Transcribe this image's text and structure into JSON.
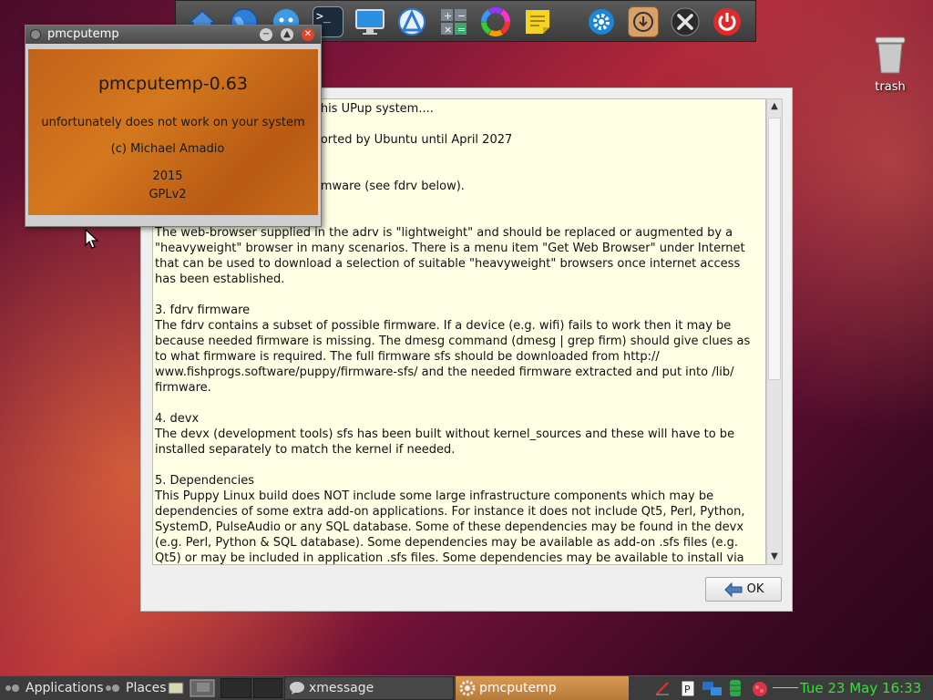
{
  "desktop": {
    "trash_label": "trash"
  },
  "dock": {
    "items": [
      {
        "name": "home",
        "icon": "home-icon"
      },
      {
        "name": "browser",
        "icon": "globe-icon"
      },
      {
        "name": "chat",
        "icon": "chat-icon"
      },
      {
        "name": "terminal",
        "icon": "terminal-icon",
        "glyph": ">_"
      },
      {
        "name": "display",
        "icon": "monitor-icon"
      },
      {
        "name": "file-manager",
        "icon": "triangle-app-icon"
      },
      {
        "name": "calculator",
        "icon": "calculator-icon"
      },
      {
        "name": "color-picker",
        "icon": "color-wheel-icon"
      },
      {
        "name": "notes",
        "icon": "sticky-note-icon"
      },
      {
        "name": "settings",
        "icon": "gear-icon"
      },
      {
        "name": "installer",
        "icon": "download-box-icon"
      },
      {
        "name": "tools",
        "icon": "tools-icon"
      },
      {
        "name": "shutdown",
        "icon": "power-icon"
      }
    ]
  },
  "message_window": {
    "text": "                                            his UPup system....\n\n                                            orted by Ubuntu until April 2027\n\n\n                                            mware (see fdrv below).\n\n\nThe web-browser supplied in the adrv is \"lightweight\" and should be replaced or augmented by a \"heavyweight\" browser in many scenarios. There is a menu item \"Get Web Browser\" under Internet that can be used to download a selection of suitable \"heavyweight\" browsers once internet access has been established.\n\n3. fdrv firmware\nThe fdrv contains a subset of possible firmware. If a device (e.g. wifi) fails to work then it may be because needed firmware is missing. The dmesg command (dmesg | grep firm) should give clues as to what firmware is required. The full firmware sfs should be downloaded from http://\nwww.fishprogs.software/puppy/firmware-sfs/ and the needed firmware extracted and put into /lib/\nfirmware.\n\n4. devx\nThe devx (development tools) sfs has been built without kernel_sources and these will have to be installed separately to match the kernel if needed.\n\n5. Dependencies\nThis Puppy Linux build does NOT include some large infrastructure components which may be dependencies of some extra add-on applications. For instance it does not include Qt5, Perl, Python, SystemD, PulseAudio or any SQL database. Some of these dependencies may be found in the devx (e.g. Perl, Python & SQL database). Some dependencies may be available as add-on .sfs files (e.g. Qt5) or may be included in application .sfs files. Some dependencies may be available to install via",
    "ok_label": "OK"
  },
  "pmcputemp_window": {
    "title": "pmcputemp",
    "heading": "pmcputemp-0.63",
    "message": "unfortunately does not work on your system",
    "copyright": "(c) Michael Amadio",
    "year": "2015",
    "license": "GPLv2"
  },
  "taskbar": {
    "applications_label": "Applications",
    "places_label": "Places",
    "tasks": [
      {
        "label": "xmessage",
        "icon": "chat-icon",
        "active": false
      },
      {
        "label": "pmcputemp",
        "icon": "gear-icon",
        "active": true
      }
    ],
    "tray": [
      "pen-icon",
      "clipboard-icon",
      "network-icon",
      "storage-icon",
      "raspberry-icon"
    ],
    "clock": "Tue 23 May 16:33"
  },
  "colors": {
    "accent_orange": "#d4781e",
    "clock_green": "#34e034",
    "message_bg": "#ffffe5"
  }
}
